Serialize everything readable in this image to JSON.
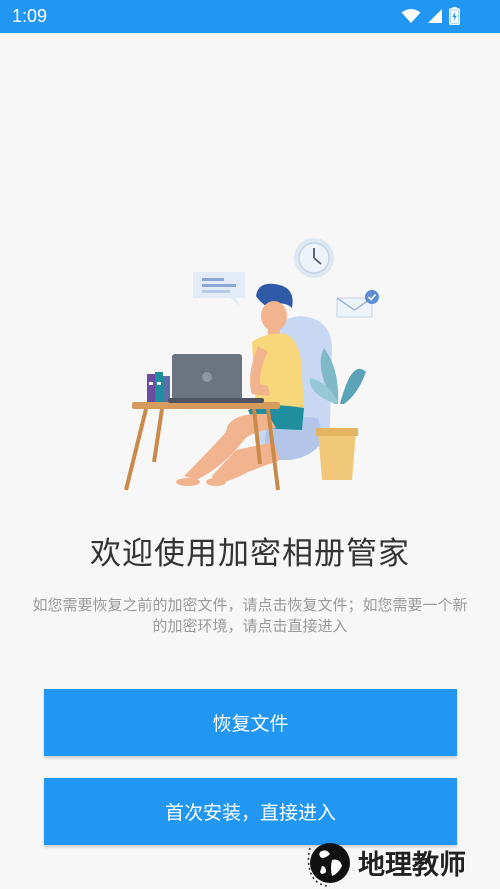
{
  "status_bar": {
    "time": "1:09",
    "icons": [
      "wifi-icon",
      "signal-icon",
      "battery-charging-icon"
    ]
  },
  "main": {
    "illustration": "person-working-on-laptop-illustration",
    "title": "欢迎使用加密相册管家",
    "description": "如您需要恢复之前的加密文件，请点击恢复文件；如您需要一个新的加密环境，请点击直接进入"
  },
  "buttons": {
    "restore_label": "恢复文件",
    "first_install_label": "首次安装，直接进入"
  },
  "watermark": {
    "text": "地理教师"
  },
  "colors": {
    "accent": "#2196f3",
    "background": "#f7f7f7",
    "title": "#333333",
    "description": "#9a9a9a"
  }
}
